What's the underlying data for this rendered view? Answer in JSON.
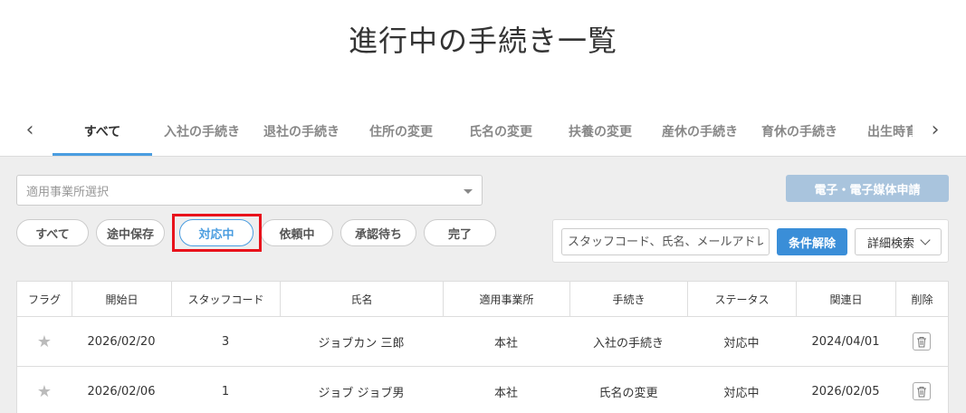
{
  "page": {
    "title": "進行中の手続き一覧"
  },
  "tabs": [
    {
      "label": "すべて",
      "active": true
    },
    {
      "label": "入社の手続き"
    },
    {
      "label": "退社の手続き"
    },
    {
      "label": "住所の変更"
    },
    {
      "label": "氏名の変更"
    },
    {
      "label": "扶養の変更"
    },
    {
      "label": "産休の手続き"
    },
    {
      "label": "育休の手続き"
    },
    {
      "label": "出生時育休"
    }
  ],
  "filters": {
    "office_select_placeholder": "適用事業所選択",
    "apply_button": "電子・電子媒体申請",
    "status_pills": [
      "すべて",
      "途中保存",
      "対応中",
      "依頼中",
      "承認待ち",
      "完了"
    ],
    "active_status": "対応中"
  },
  "search": {
    "placeholder": "スタッフコード、氏名、メールアドレス",
    "clear_button": "条件解除",
    "detail_button": "詳細検索"
  },
  "table": {
    "columns": [
      "フラグ",
      "開始日",
      "スタッフコード",
      "氏名",
      "適用事業所",
      "手続き",
      "ステータス",
      "関連日",
      "削除"
    ],
    "rows": [
      {
        "start": "2026/02/20",
        "code": "3",
        "name": "ジョブカン 三郎",
        "office": "本社",
        "procedure": "入社の手続き",
        "status": "対応中",
        "related": "2024/04/01"
      },
      {
        "start": "2026/02/06",
        "code": "1",
        "name": "ジョブ ジョブ男",
        "office": "本社",
        "procedure": "氏名の変更",
        "status": "対応中",
        "related": "2026/02/05"
      }
    ]
  },
  "colors": {
    "accent": "#4a9de0",
    "highlight": "#e8121b",
    "apply_disabled": "#a9c4dd"
  }
}
